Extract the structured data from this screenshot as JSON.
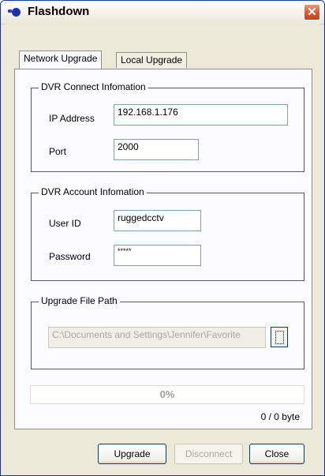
{
  "window": {
    "title": "Flashdown",
    "close_glyph": "✕",
    "icon": "app-icon"
  },
  "tabs": [
    {
      "label": "Network Upgrade",
      "active": true
    },
    {
      "label": "Local Upgrade",
      "active": false
    }
  ],
  "connect": {
    "title": "DVR Connect Infomation",
    "ip_label": "IP Address",
    "ip_value": "192.168.1.176",
    "port_label": "Port",
    "port_value": "2000"
  },
  "account": {
    "title": "DVR Account Infomation",
    "user_label": "User ID",
    "user_value": "ruggedcctv",
    "password_label": "Password",
    "password_value": "*****"
  },
  "upgrade": {
    "title": "Upgrade File Path",
    "path_value": "C:\\Documents and Settings\\Jennifer\\Favorite",
    "browse_icon": "browse-icon"
  },
  "progress": {
    "percent_text": "0%",
    "value": 0,
    "bytes_text": "0 / 0 byte"
  },
  "buttons": {
    "upgrade": "Upgrade",
    "disconnect": "Disconnect",
    "close": "Close"
  },
  "colors": {
    "title_border": "#0831d9",
    "close_button": "#d65a34",
    "panel": "#ece9d8",
    "tab_page": "#fcfcfe"
  }
}
